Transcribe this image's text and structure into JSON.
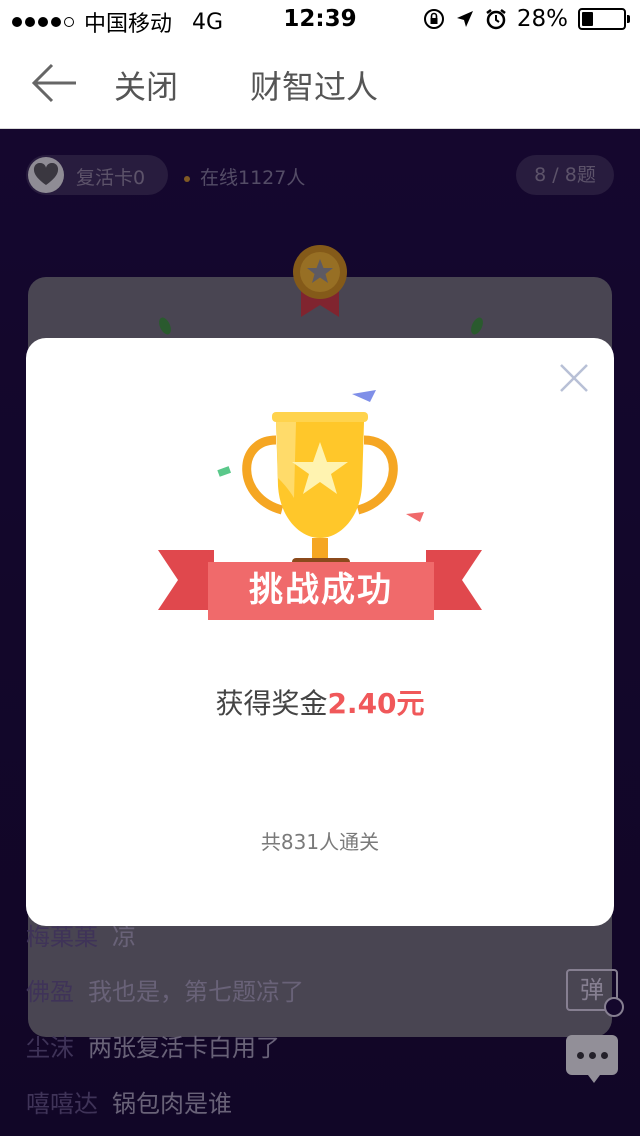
{
  "status_bar": {
    "carrier": "中国移动",
    "network": "4G",
    "time": "12:39",
    "battery": "28%",
    "battery_level": 0.28,
    "icons": [
      "signal-dots-icon",
      "rotation-lock-icon",
      "location-arrow-icon",
      "alarm-icon",
      "battery-icon"
    ]
  },
  "nav": {
    "back_icon": "arrow-left-icon",
    "close_label": "关闭",
    "title": "财智过人"
  },
  "game": {
    "revive_card": "复活卡0",
    "online": "在线1127人",
    "progress": "8 / 8题"
  },
  "chat": [
    {
      "user": "梅菓菓",
      "msg": "凉"
    },
    {
      "user": "佛盈",
      "msg": "我也是，第七题凉了"
    },
    {
      "user": "尘沫",
      "msg": "两张复活卡白用了"
    },
    {
      "user": "嘻嘻达",
      "msg": "锅包肉是谁"
    }
  ],
  "danmu_label": "弹",
  "modal": {
    "ribbon": "挑战成功",
    "prize_prefix": "获得奖金",
    "prize_amount": "2.40元",
    "passed": "共831人通关"
  },
  "colors": {
    "background": "#1c0c3a",
    "accent_red": "#f0585a",
    "ribbon": "#f06a6b",
    "trophy_gold": "#ffc72a"
  }
}
